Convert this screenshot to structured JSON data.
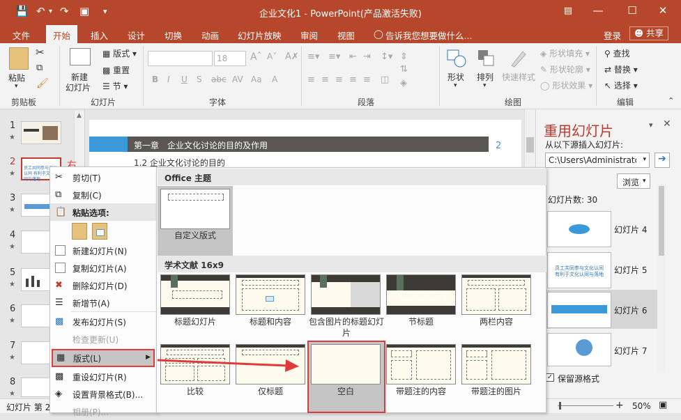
{
  "window": {
    "title": "企业文化1 - PowerPoint(产品激活失败)",
    "brand_color": "#b7472a"
  },
  "tabs": [
    {
      "label": "文件"
    },
    {
      "label": "开始"
    },
    {
      "label": "插入"
    },
    {
      "label": "设计"
    },
    {
      "label": "切换"
    },
    {
      "label": "动画"
    },
    {
      "label": "幻灯片放映"
    },
    {
      "label": "审阅"
    },
    {
      "label": "视图"
    }
  ],
  "tell_me": "告诉我您想要做什么...",
  "login": "登录",
  "share": "共享",
  "ribbon": {
    "clipboard": {
      "paste": "粘贴",
      "label": "剪贴板"
    },
    "slides": {
      "new_slide_1": "新建",
      "new_slide_2": "幻灯片",
      "layout": "版式",
      "reset": "重置",
      "section": "节",
      "label": "幻灯片"
    },
    "font": {
      "size": "18",
      "label": "字体"
    },
    "paragraph": {
      "label": "段落"
    },
    "drawing": {
      "shape": "形状",
      "arrange": "排列",
      "quick_styles": "快速样式",
      "fill": "形状填充",
      "outline": "形状轮廓",
      "effect": "形状效果",
      "label": "绘图"
    },
    "editing": {
      "find": "查找",
      "replace": "替换",
      "select": "选择",
      "label": "编辑"
    }
  },
  "slide_thumbs": [
    {
      "num": "1"
    },
    {
      "num": "2"
    },
    {
      "num": "3"
    },
    {
      "num": "4"
    },
    {
      "num": "5"
    },
    {
      "num": "6"
    },
    {
      "num": "7"
    },
    {
      "num": "8"
    }
  ],
  "annotation": "右击",
  "thumb2_text": "员工共同参与文化认同 有利于文化认同与落地",
  "slide": {
    "chapter": "第一章　企业文化讨论的目的及作用",
    "page_no": "2",
    "section": "1.2  企业文化讨论的目的"
  },
  "context_menu": [
    {
      "label": "剪切(T)"
    },
    {
      "label": "复制(C)"
    },
    {
      "label": "粘贴选项:"
    },
    {
      "label": "新建幻灯片(N)"
    },
    {
      "label": "复制幻灯片(A)"
    },
    {
      "label": "删除幻灯片(D)"
    },
    {
      "label": "新增节(A)"
    },
    {
      "label": "发布幻灯片(S)"
    },
    {
      "label": "检查更新(U)"
    },
    {
      "label": "版式(L)"
    },
    {
      "label": "重设幻灯片(R)"
    },
    {
      "label": "设置背景格式(B)..."
    },
    {
      "label": "相册(P)..."
    }
  ],
  "layout_gallery": {
    "office_header": "Office 主题",
    "office_layouts": [
      {
        "label": "自定义版式"
      }
    ],
    "academic_header": "学术文献 16x9",
    "academic_layouts": [
      {
        "label": "标题幻灯片"
      },
      {
        "label": "标题和内容"
      },
      {
        "label": "包含图片的标题幻灯片"
      },
      {
        "label": "节标题"
      },
      {
        "label": "两栏内容"
      },
      {
        "label": "比较"
      },
      {
        "label": "仅标题"
      },
      {
        "label": "空白"
      },
      {
        "label": "带题注的内容"
      },
      {
        "label": "带题注的图片"
      }
    ]
  },
  "reuse_pane": {
    "title": "重用幻灯片",
    "insert_from": "从以下源插入幻灯片:",
    "path": "C:\\Users\\Administrato",
    "browse": "浏览",
    "count": "幻灯片数: 30",
    "slides": [
      {
        "label": "幻灯片 4"
      },
      {
        "label": "幻灯片 5"
      },
      {
        "label": "幻灯片 6"
      },
      {
        "label": "幻灯片 7"
      }
    ],
    "keep_format": "保留源格式",
    "accent_color": "#c0392b"
  },
  "status": {
    "slide_info": "幻灯片 第 2",
    "zoom": "50%"
  },
  "highlight_color": "#e03a3a"
}
